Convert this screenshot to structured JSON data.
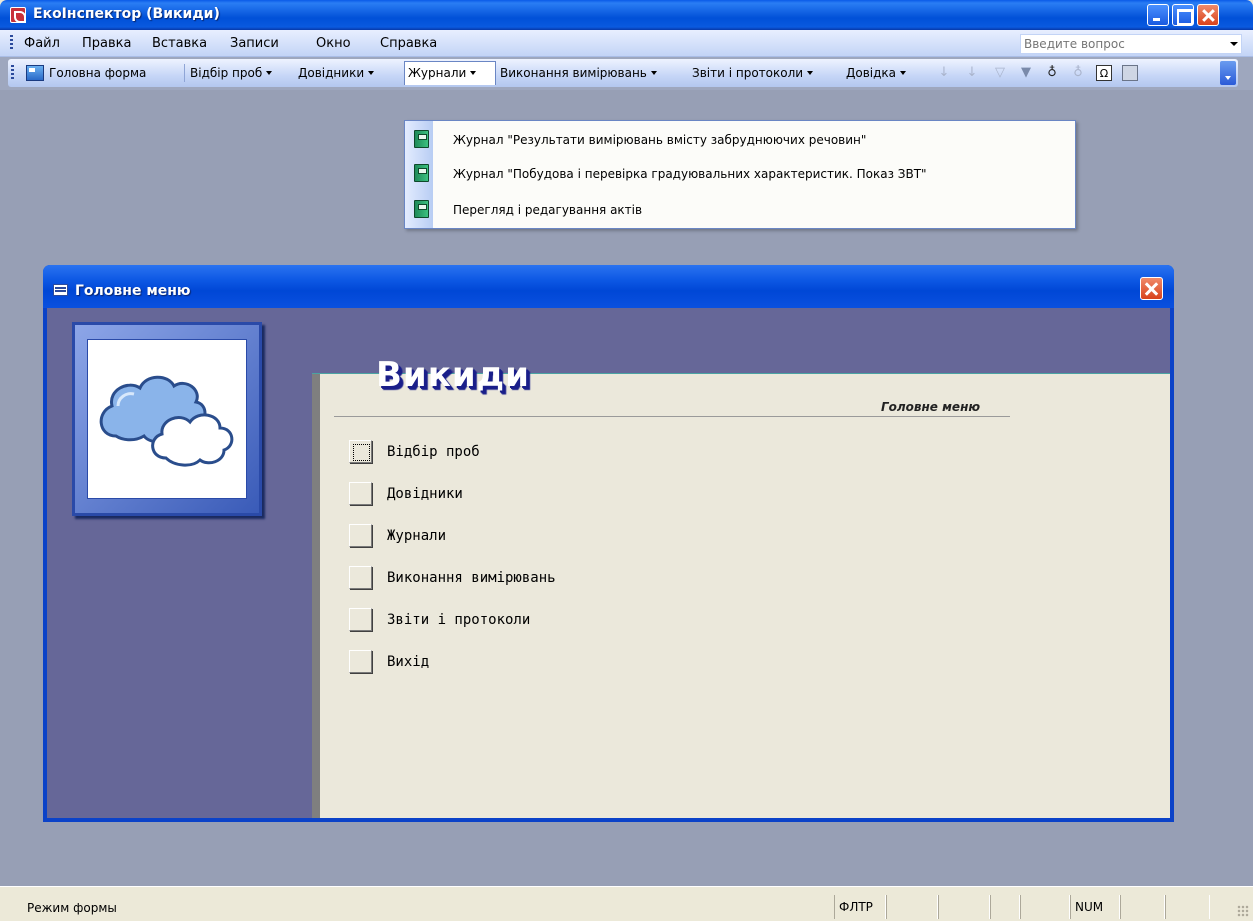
{
  "app": {
    "title": "ЕкоІнспектор (Викиди)"
  },
  "menubar": {
    "items": [
      "Файл",
      "Правка",
      "Вставка",
      "Записи",
      "Окно",
      "Справка"
    ],
    "ask_placeholder": "Введите вопрос"
  },
  "toolbar": {
    "items": [
      {
        "label": "Головна форма",
        "dropdown": false
      },
      {
        "label": "Відбір проб",
        "dropdown": true
      },
      {
        "label": "Довідники",
        "dropdown": true
      },
      {
        "label": "Журнали",
        "dropdown": true,
        "active": true
      },
      {
        "label": "Виконання вимірювань",
        "dropdown": true
      },
      {
        "label": "Звіти і протоколи",
        "dropdown": true
      },
      {
        "label": "Довідка",
        "dropdown": true
      }
    ],
    "icons": [
      "sort-ascending-icon",
      "sort-descending-icon",
      "filter-by-selection-icon",
      "apply-filter-icon",
      "find-icon",
      "replace-icon",
      "symbol-icon",
      "calculator-icon",
      "toolbar-options-icon"
    ]
  },
  "dropdown": {
    "items": [
      "Журнал \"Результати вимірювань вмісту забруднюючих речовин\"",
      "Журнал \"Побудова і перевірка градуювальних характеристик. Показ ЗВТ\"",
      "Перегляд і редагування актів"
    ]
  },
  "form": {
    "title": "Головне меню",
    "heading": "Викиди",
    "subheading": "Головне меню",
    "buttons": [
      "Відбір проб",
      "Довідники",
      "Журнали",
      "Виконання вимірювань",
      "Звіти і протоколи",
      "Вихід"
    ]
  },
  "statusbar": {
    "mode": "Режим формы",
    "filter": "ФЛТР",
    "num": "NUM"
  },
  "colors": {
    "titlebar": "#0a5ae8",
    "mdi_background": "#979fb5",
    "switchboard_panel": "#666798",
    "form_background": "#ebe8db"
  }
}
